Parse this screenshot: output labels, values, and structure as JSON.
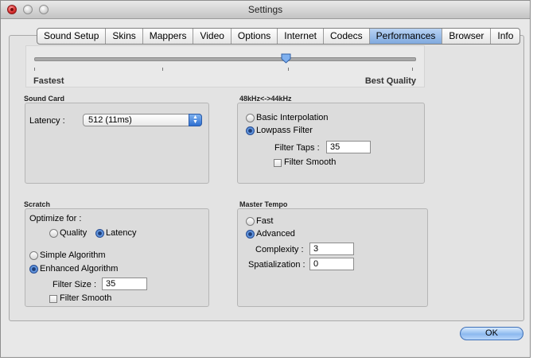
{
  "window": {
    "title": "Settings"
  },
  "tabs": [
    "Sound Setup",
    "Skins",
    "Mappers",
    "Video",
    "Options",
    "Internet",
    "Codecs",
    "Performances",
    "Browser",
    "Info"
  ],
  "active_tab": "Performances",
  "quality_slider": {
    "left_label": "Fastest",
    "right_label": "Best Quality",
    "value": 0.66
  },
  "sound_card": {
    "title": "Sound Card",
    "latency_label": "Latency :",
    "latency_value": "512 (11ms)"
  },
  "resampling": {
    "title": "48kHz<->44kHz",
    "basic_label": "Basic Interpolation",
    "lowpass_label": "Lowpass Filter",
    "filter_taps_label": "Filter Taps :",
    "filter_taps_value": "35",
    "filter_smooth_label": "Filter Smooth"
  },
  "scratch": {
    "title": "Scratch",
    "optimize_label": "Optimize for :",
    "quality_label": "Quality",
    "latency_label": "Latency",
    "simple_label": "Simple Algorithm",
    "enhanced_label": "Enhanced Algorithm",
    "filter_size_label": "Filter Size :",
    "filter_size_value": "35",
    "filter_smooth_label": "Filter Smooth"
  },
  "master_tempo": {
    "title": "Master Tempo",
    "fast_label": "Fast",
    "advanced_label": "Advanced",
    "complexity_label": "Complexity :",
    "complexity_value": "3",
    "spatialization_label": "Spatialization :",
    "spatialization_value": "0"
  },
  "ok_label": "OK"
}
